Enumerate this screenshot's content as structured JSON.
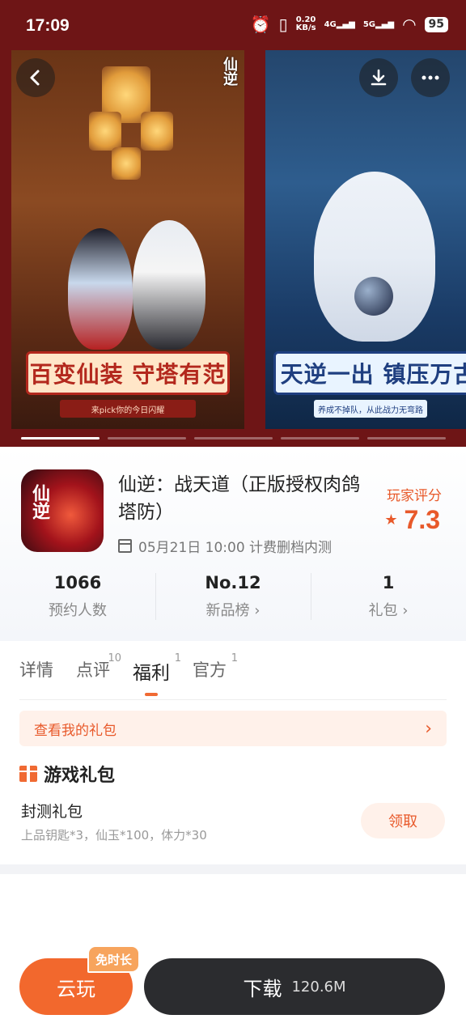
{
  "status_bar": {
    "time": "17:09",
    "net_speed_value": "0.20",
    "net_speed_unit": "KB/s",
    "signal_1": "4G",
    "signal_2": "5G",
    "battery": "95"
  },
  "banners": [
    {
      "caption": "百变仙装 守塔有范",
      "subcaption": "来pick你的今日闪耀",
      "logo": "仙逆"
    },
    {
      "caption": "天逆一出 镇压万古",
      "subcaption": "养成不掉队，从此战力无弯路"
    }
  ],
  "carousel": {
    "count": 5,
    "active": 0
  },
  "app": {
    "title": "仙逆：战天道（正版授权肉鸽塔防）",
    "schedule": "05月21日 10:00 计费删档内测",
    "rating_label": "玩家评分",
    "rating_value": "7.3",
    "icon_text": "仙逆"
  },
  "stats": [
    {
      "value": "1066",
      "label": "预约人数"
    },
    {
      "value": "No.12",
      "label": "新品榜 ›"
    },
    {
      "value": "1",
      "label": "礼包 ›"
    }
  ],
  "tabs": [
    {
      "label": "详情",
      "badge": ""
    },
    {
      "label": "点评",
      "badge": "10"
    },
    {
      "label": "福利",
      "badge": "1"
    },
    {
      "label": "官方",
      "badge": "1"
    }
  ],
  "active_tab": "福利",
  "my_gift_link": "查看我的礼包",
  "gift_section": {
    "title": "游戏礼包",
    "items": [
      {
        "name": "封测礼包",
        "desc": "上品钥匙*3，仙玉*100，体力*30",
        "action": "领取"
      }
    ]
  },
  "bottom_bar": {
    "cloud_label": "云玩",
    "cloud_tag": "免时长",
    "download_label": "下载",
    "download_size": "120.6M"
  },
  "colors": {
    "accent": "#f2682d",
    "header_bg": "#6e1516",
    "dark_button": "#2b2c2f"
  }
}
